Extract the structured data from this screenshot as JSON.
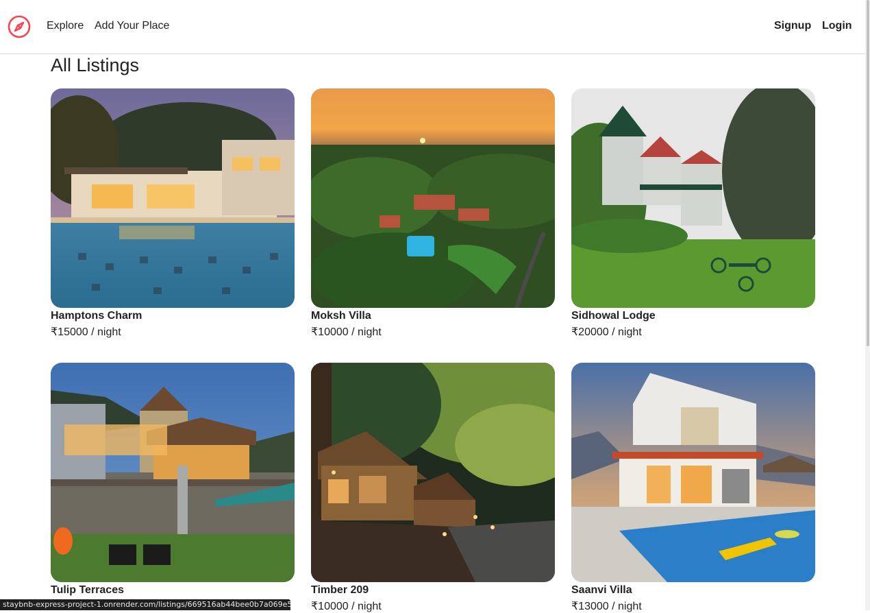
{
  "nav": {
    "explore": "Explore",
    "add_place": "Add Your Place",
    "signup": "Signup",
    "login": "Login",
    "logo_icon": "compass-icon",
    "accent_color": "#fe424d"
  },
  "page": {
    "title": "All Listings"
  },
  "listings": [
    {
      "title": "Hamptons Charm",
      "price": "₹15000 / night"
    },
    {
      "title": "Moksh Villa",
      "price": "₹10000 / night"
    },
    {
      "title": "Sidhowal Lodge",
      "price": "₹20000 / night"
    },
    {
      "title": "Tulip Terraces",
      "price": ""
    },
    {
      "title": "Timber 209",
      "price": "₹10000 / night"
    },
    {
      "title": "Saanvi Villa",
      "price": "₹13000 / night"
    }
  ],
  "status_bar": {
    "url": "staybnb-express-project-1.onrender.com/listings/669516ab44bee0b7a069e5..."
  }
}
